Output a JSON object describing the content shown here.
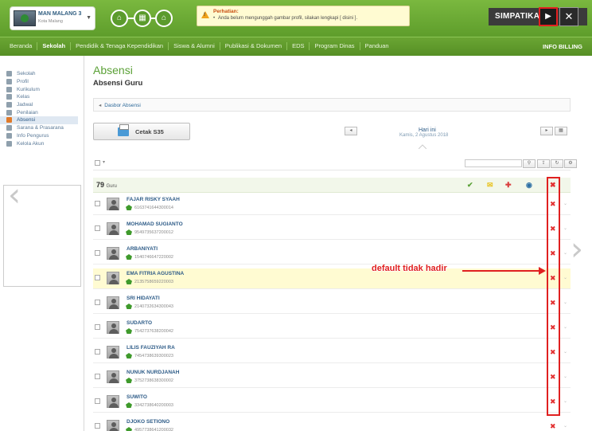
{
  "header": {
    "school_name": "MAN MALANG 3",
    "school_city": "Kota Malang",
    "alert_title": "Perhatian:",
    "alert_message": "Anda belum mengunggah gambar profil, silakan lengkapi [ disini ].",
    "brand": "SIMPATIKA"
  },
  "nav": {
    "items": [
      "Beranda",
      "Sekolah",
      "Pendidik & Tenaga Kependidikan",
      "Siswa & Alumni",
      "Publikasi & Dokumen",
      "EDS",
      "Program Dinas",
      "Panduan"
    ],
    "active": "Sekolah",
    "billing": "INFO BILLING"
  },
  "sidebar": {
    "items": [
      {
        "label": "Sekolah",
        "icon": "info-icon"
      },
      {
        "label": "Profil",
        "icon": "profile-icon"
      },
      {
        "label": "Kurikulum",
        "icon": "book-icon"
      },
      {
        "label": "Kelas",
        "icon": "class-icon"
      },
      {
        "label": "Jadwal",
        "icon": "calendar-icon"
      },
      {
        "label": "Penilaian",
        "icon": "grade-icon"
      },
      {
        "label": "Absensi",
        "icon": "checkbox-icon"
      },
      {
        "label": "Sarana & Prasarana",
        "icon": "building-icon"
      },
      {
        "label": "Info Pengurus",
        "icon": "person-icon"
      },
      {
        "label": "Kelola Akun",
        "icon": "crown-icon"
      }
    ],
    "active_index": 6
  },
  "page": {
    "title": "Absensi",
    "subtitle": "Absensi Guru",
    "breadcrumb": "Dasbor Absensi",
    "print_button": "Cetak S35",
    "day_label": "Hari ini",
    "date_label": "Kamis, 2 Agustus 2018",
    "count": "79",
    "count_unit": "Guru"
  },
  "teachers": [
    {
      "name": "FAJAR RISKY SYAAH",
      "nip": "6163741644300014"
    },
    {
      "name": "MOHAMAD SUGIANTO",
      "nip": "9549735637200012"
    },
    {
      "name": "ARBANIYATI",
      "nip": "1540746647220002"
    },
    {
      "name": "EMA FITRIA AGUSTINA",
      "nip": "2135758659220003"
    },
    {
      "name": "SRI HIDAYATI",
      "nip": "2140732634300043"
    },
    {
      "name": "SUDARTO",
      "nip": "7542737638200042"
    },
    {
      "name": "LILIS FAUZIYAH RA",
      "nip": "7454738639300023"
    },
    {
      "name": "NUNUK NURDJANAH",
      "nip": "3752738638300002"
    },
    {
      "name": "SUWITO",
      "nip": "3342738640200003"
    },
    {
      "name": "DJOKO SETIONO",
      "nip": "4957738641200032"
    }
  ],
  "annotation": "default tidak hadir",
  "colors": {
    "accent": "#5ba137",
    "absent": "#e23030",
    "annotation": "#e02020"
  }
}
